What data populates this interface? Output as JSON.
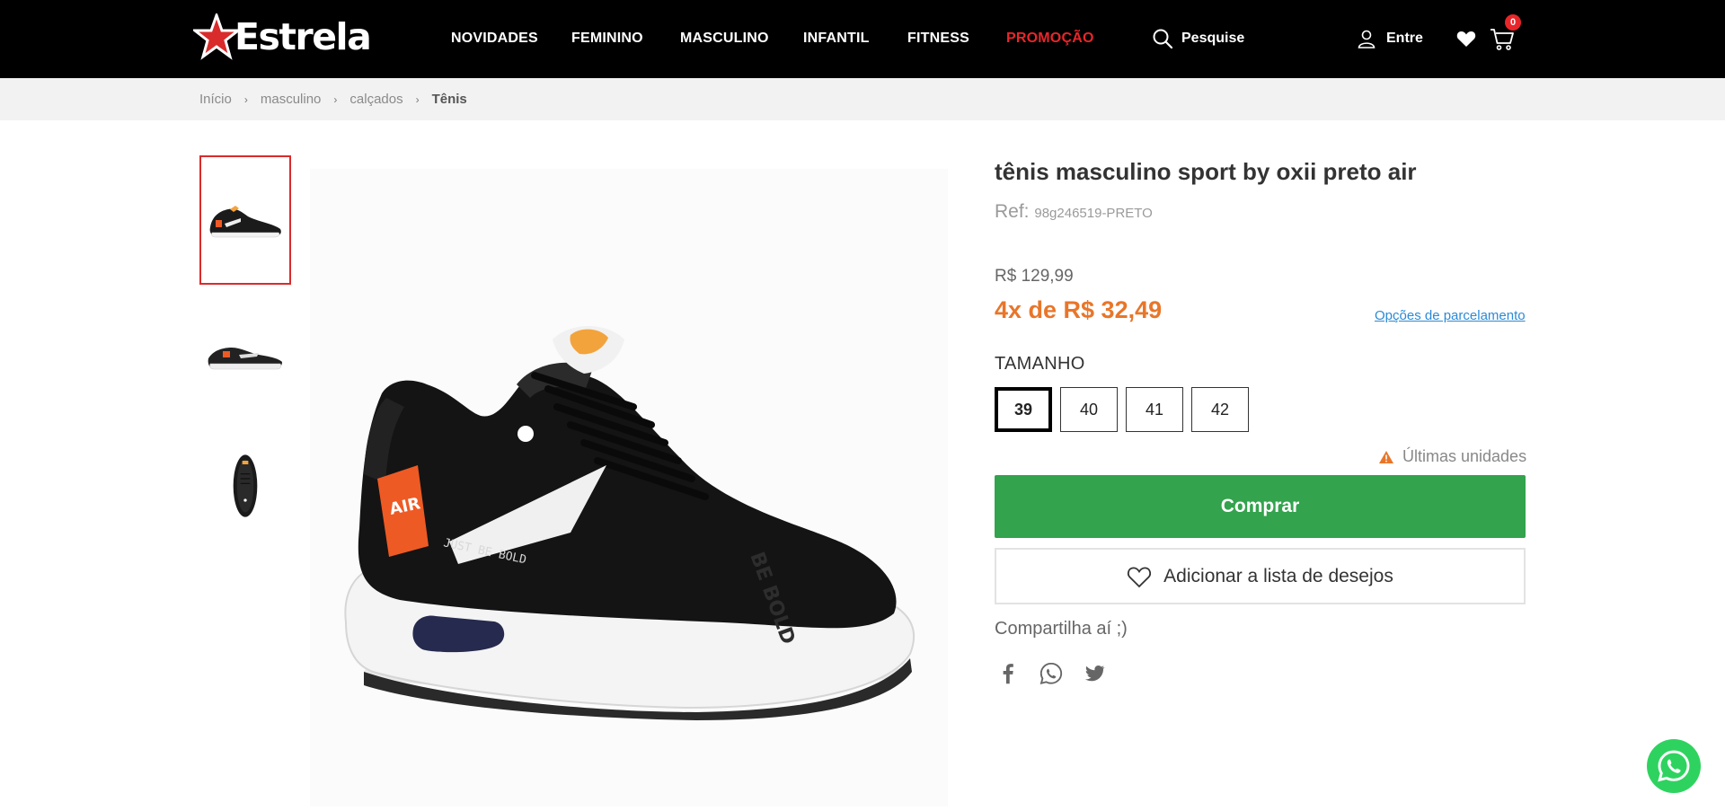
{
  "header": {
    "logo_text": "Estrela",
    "nav": [
      {
        "label": "NOVIDADES"
      },
      {
        "label": "FEMININO"
      },
      {
        "label": "MASCULINO"
      },
      {
        "label": "INFANTIL"
      },
      {
        "label": "FITNESS"
      },
      {
        "label": "PROMOÇÃO"
      }
    ],
    "search_label": "Pesquise",
    "login_label": "Entre",
    "cart_count": "0",
    "colors": {
      "background": "#000000",
      "promo": "#e8262a",
      "logo_star": "#d92b2b"
    }
  },
  "breadcrumb": {
    "items": [
      {
        "label": "Início"
      },
      {
        "label": "masculino"
      },
      {
        "label": "calçados"
      },
      {
        "label": "Tênis"
      }
    ]
  },
  "gallery": {
    "thumbnail_count": 3,
    "selected_index": 0
  },
  "product": {
    "title": "tênis masculino sport by oxii preto air",
    "ref_label": "Ref:",
    "ref_code": "98g246519-PRETO",
    "price": "R$ 129,99",
    "installments": "4x de R$ 32,49",
    "installments_link": "Opções de parcelamento",
    "size_label": "TAMANHO",
    "sizes": [
      "39",
      "40",
      "41",
      "42"
    ],
    "selected_size": "39",
    "stock_warning": "Últimas unidades",
    "buy_label": "Comprar",
    "wishlist_label": "Adicionar a lista de desejos",
    "share_label": "Compartilha aí ;)",
    "share_icons": [
      "facebook-icon",
      "whatsapp-icon",
      "twitter-icon"
    ],
    "colors": {
      "installments": "#e8762a",
      "buy": "#33a34d",
      "link": "#2b8ad6"
    }
  },
  "floating": {
    "icon": "whatsapp-icon",
    "color": "#2ed35f"
  }
}
